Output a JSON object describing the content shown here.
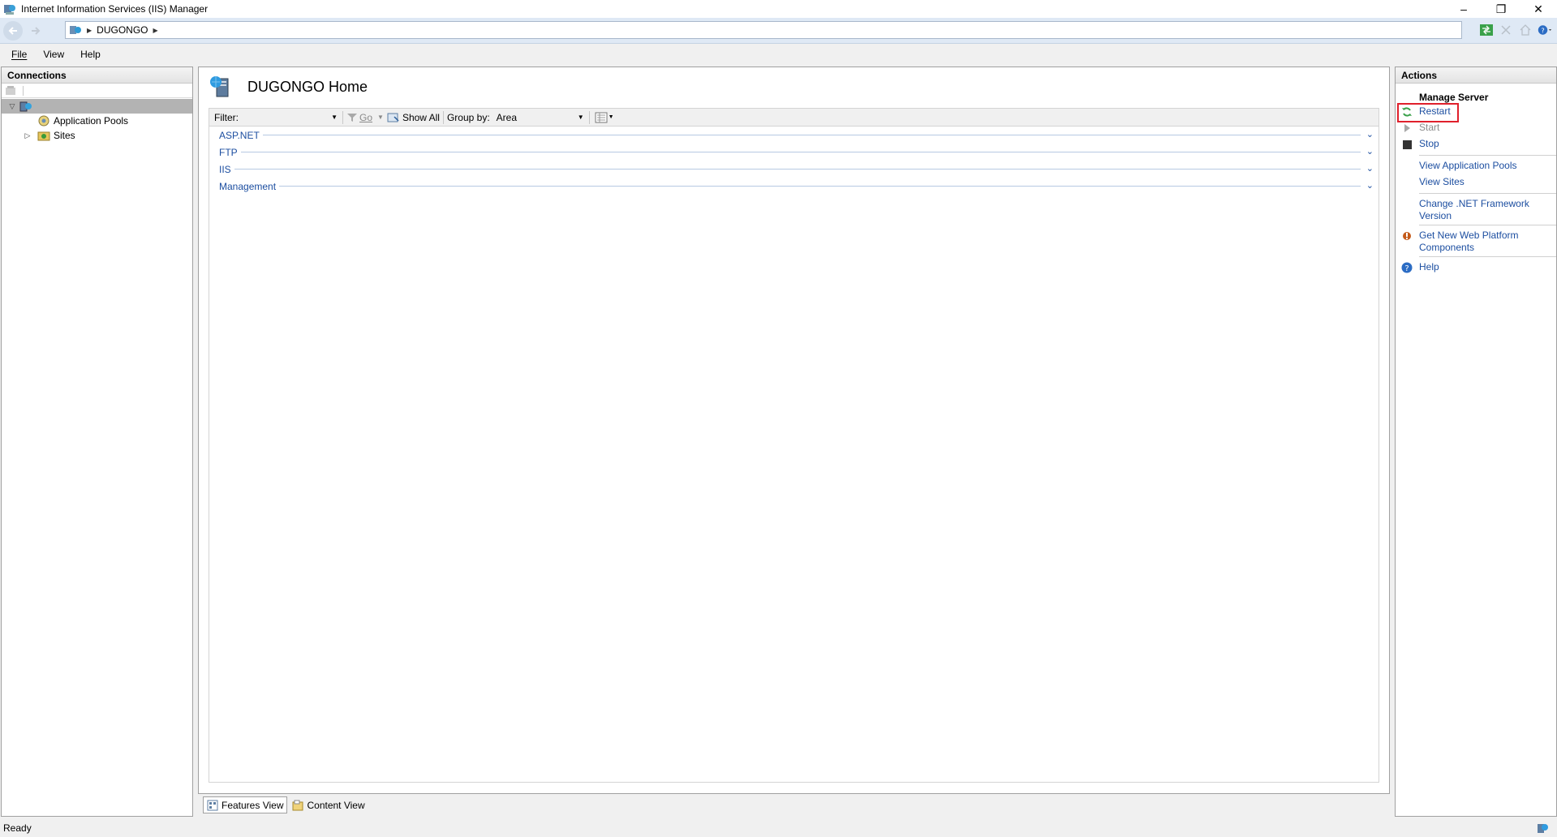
{
  "window": {
    "title": "Internet Information Services (IIS) Manager",
    "minimize_glyph": "–",
    "restore_glyph": "❐",
    "close_glyph": "✕"
  },
  "address": {
    "crumbs": [
      "DUGONGO"
    ]
  },
  "menu": [
    {
      "label": "File",
      "underline": "F"
    },
    {
      "label": "View",
      "underline": "V"
    },
    {
      "label": "Help",
      "underline": "H"
    }
  ],
  "connections": {
    "header": "Connections",
    "tree": {
      "root_label": "",
      "children": [
        {
          "label": "Application Pools",
          "icon": "app-pools-icon"
        },
        {
          "label": "Sites",
          "icon": "sites-icon",
          "expandable": true
        }
      ]
    }
  },
  "main": {
    "title": "DUGONGO Home",
    "filter": {
      "label": "Filter:",
      "value": "",
      "go_label": "Go",
      "show_all_label": "Show All",
      "group_by_label": "Group by:",
      "group_by_value": "Area"
    },
    "groups": [
      "ASP.NET",
      "FTP",
      "IIS",
      "Management"
    ],
    "view_tabs": [
      {
        "label": "Features View",
        "active": true
      },
      {
        "label": "Content View",
        "active": false
      }
    ]
  },
  "actions": {
    "header": "Actions",
    "section_title": "Manage Server",
    "items": [
      {
        "label": "Restart",
        "enabled": true,
        "icon": "restart-icon"
      },
      {
        "label": "Start",
        "enabled": false,
        "icon": "start-icon"
      },
      {
        "label": "Stop",
        "enabled": true,
        "icon": "stop-icon"
      }
    ],
    "links": [
      {
        "label": "View Application Pools"
      },
      {
        "label": "View Sites"
      }
    ],
    "links2": [
      {
        "label": "Change .NET Framework Version"
      },
      {
        "label": "Get New Web Platform Components",
        "icon": "web-platform-icon"
      }
    ],
    "help_label": "Help"
  },
  "status": {
    "text": "Ready"
  },
  "colors": {
    "link": "#1c4ea0",
    "highlight": "#e0202c"
  }
}
